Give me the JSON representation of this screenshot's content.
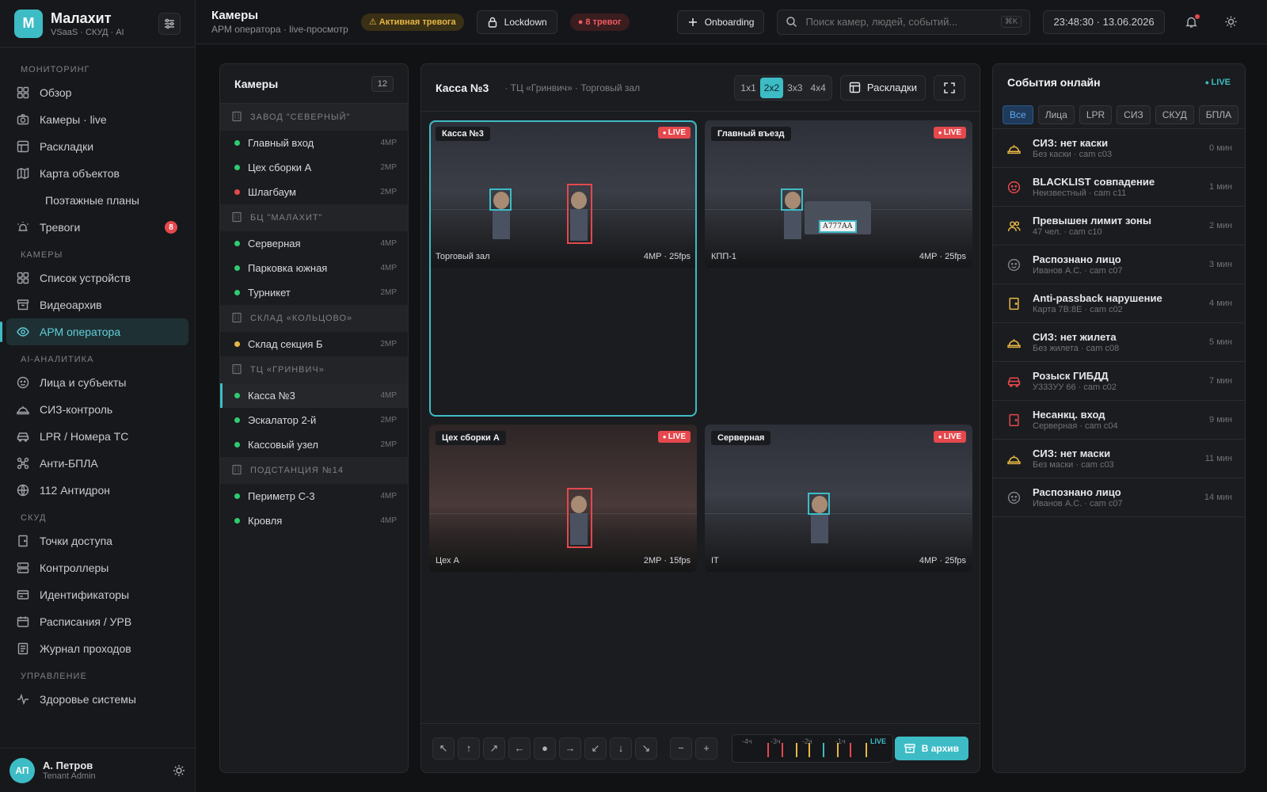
{
  "brand": {
    "logo_letter": "М",
    "name": "Малахит",
    "subtitle": "VSaaS · СКУД · AI"
  },
  "nav": {
    "sections": [
      {
        "title": "Мониторинг",
        "items": [
          {
            "label": "Обзор",
            "icon": "grid-icon"
          },
          {
            "label": "Камеры · live",
            "icon": "camera-icon"
          },
          {
            "label": "Раскладки",
            "icon": "layout-icon"
          },
          {
            "label": "Карта объектов",
            "icon": "map-icon"
          },
          {
            "label": "Поэтажные планы",
            "icon": ""
          },
          {
            "label": "Тревоги",
            "icon": "alarm-icon",
            "badge": "8"
          }
        ]
      },
      {
        "title": "Камеры",
        "items": [
          {
            "label": "Список устройств",
            "icon": "grid-icon"
          },
          {
            "label": "Видеоархив",
            "icon": "archive-icon"
          },
          {
            "label": "АРМ оператора",
            "icon": "eye-icon",
            "active": true
          }
        ]
      },
      {
        "title": "AI-аналитика",
        "items": [
          {
            "label": "Лица и субъекты",
            "icon": "face-icon"
          },
          {
            "label": "СИЗ-контроль",
            "icon": "helmet-icon"
          },
          {
            "label": "LPR / Номера ТС",
            "icon": "car-icon"
          },
          {
            "label": "Анти-БПЛА",
            "icon": "drone-icon"
          },
          {
            "label": "112 Антидрон",
            "icon": "globe-icon"
          }
        ]
      },
      {
        "title": "СКУД",
        "items": [
          {
            "label": "Точки доступа",
            "icon": "door-icon"
          },
          {
            "label": "Контроллеры",
            "icon": "server-icon"
          },
          {
            "label": "Идентификаторы",
            "icon": "card-icon"
          },
          {
            "label": "Расписания / УРВ",
            "icon": "calendar-icon"
          },
          {
            "label": "Журнал проходов",
            "icon": "log-icon"
          }
        ]
      },
      {
        "title": "Управление",
        "items": [
          {
            "label": "Здоровье системы",
            "icon": "pulse-icon"
          }
        ]
      }
    ]
  },
  "user": {
    "initials": "АП",
    "name": "А. Петров",
    "role": "Tenant Admin"
  },
  "topbar": {
    "title": "Камеры",
    "subtitle": "АРМ оператора · live-просмотр",
    "alert_chip": "⚠ Активная тревога",
    "lockdown": "Lockdown",
    "alarms_chip": "● 8 тревог",
    "onboarding": "Onboarding",
    "search_placeholder": "Поиск камер, людей, событий...",
    "search_kbd": "⌘K",
    "clock": "23:48:30 · 13.06.2026"
  },
  "cameras": {
    "title": "Камеры",
    "count": "12",
    "groups": [
      {
        "name": "ЗАВОД \"СЕВЕРНЫЙ\"",
        "items": [
          {
            "name": "Главный вход",
            "status": "#2ecc71",
            "res": "4MP"
          },
          {
            "name": "Цех сборки А",
            "status": "#2ecc71",
            "res": "2MP"
          },
          {
            "name": "Шлагбаум",
            "status": "#e5484d",
            "res": "2MP"
          }
        ]
      },
      {
        "name": "БЦ \"МАЛАХИТ\"",
        "items": [
          {
            "name": "Серверная",
            "status": "#2ecc71",
            "res": "4MP"
          },
          {
            "name": "Парковка южная",
            "status": "#2ecc71",
            "res": "4MP"
          },
          {
            "name": "Турникет",
            "status": "#2ecc71",
            "res": "2MP"
          }
        ]
      },
      {
        "name": "СКЛАД «КОЛЬЦОВО»",
        "items": [
          {
            "name": "Склад секция Б",
            "status": "#e7b744",
            "res": "2MP"
          }
        ]
      },
      {
        "name": "ТЦ «ГРИНВИЧ»",
        "items": [
          {
            "name": "Касса №3",
            "status": "#2ecc71",
            "res": "4MP",
            "active": true
          },
          {
            "name": "Эскалатор 2-й",
            "status": "#2ecc71",
            "res": "2MP"
          },
          {
            "name": "Кассовый узел",
            "status": "#2ecc71",
            "res": "2MP"
          }
        ]
      },
      {
        "name": "ПОДСТАНЦИЯ №14",
        "items": [
          {
            "name": "Периметр С-3",
            "status": "#2ecc71",
            "res": "4MP"
          },
          {
            "name": "Кровля",
            "status": "#2ecc71",
            "res": "4MP"
          }
        ]
      }
    ]
  },
  "viewer": {
    "title": "Касса №3",
    "path": "· ТЦ «Гринвич» · Торговый зал",
    "grid_options": [
      "1x1",
      "2x2",
      "3x3",
      "4x4"
    ],
    "grid_selected": "2x2",
    "layouts_label": "Раскладки",
    "tiles": [
      {
        "name": "Касса №3",
        "live": "LIVE",
        "location": "Торговый зал",
        "meta": "4MP · 25fps"
      },
      {
        "name": "Главный въезд",
        "live": "LIVE",
        "location": "КПП-1",
        "meta": "4MP · 25fps",
        "plate": "А777АА"
      },
      {
        "name": "Цех сборки А",
        "live": "LIVE",
        "location": "Цех А",
        "meta": "2MP · 15fps"
      },
      {
        "name": "Серверная",
        "live": "LIVE",
        "location": "IT",
        "meta": "4MP · 25fps"
      }
    ],
    "timeline": {
      "labels": [
        "-4ч",
        "-3ч",
        "-2ч",
        "-1ч"
      ],
      "live": "LIVE"
    },
    "archive_label": "В архив"
  },
  "events": {
    "title": "События онлайн",
    "live": "LIVE",
    "filters": [
      "Все",
      "Лица",
      "LPR",
      "СИЗ",
      "СКУД",
      "БПЛА"
    ],
    "items": [
      {
        "title": "СИЗ: нет каски",
        "sub": "Без каски · cam c03",
        "time": "0 мин",
        "icon": "helmet-icon",
        "color": "#e7b744"
      },
      {
        "title": "BLACKLIST совпадение",
        "sub": "Неизвестный · cam c11",
        "time": "1 мин",
        "icon": "face-icon",
        "color": "#e5484d"
      },
      {
        "title": "Превышен лимит зоны",
        "sub": "47 чел. · cam c10",
        "time": "2 мин",
        "icon": "users-icon",
        "color": "#e7b744"
      },
      {
        "title": "Распознано лицо",
        "sub": "Иванов А.С. · cam c07",
        "time": "3 мин",
        "icon": "face-icon",
        "color": "#7c8087"
      },
      {
        "title": "Anti-passback нарушение",
        "sub": "Карта 7B:8E · cam c02",
        "time": "4 мин",
        "icon": "door-icon",
        "color": "#e7b744"
      },
      {
        "title": "СИЗ: нет жилета",
        "sub": "Без жилета · cam c08",
        "time": "5 мин",
        "icon": "helmet-icon",
        "color": "#e7b744"
      },
      {
        "title": "Розыск ГИБДД",
        "sub": "У333УУ 66 · cam c02",
        "time": "7 мин",
        "icon": "car-icon",
        "color": "#e5484d"
      },
      {
        "title": "Несанкц. вход",
        "sub": "Серверная · cam c04",
        "time": "9 мин",
        "icon": "door-icon",
        "color": "#e5484d"
      },
      {
        "title": "СИЗ: нет маски",
        "sub": "Без маски · cam c03",
        "time": "11 мин",
        "icon": "helmet-icon",
        "color": "#e7b744"
      },
      {
        "title": "Распознано лицо",
        "sub": "Иванов А.С. · cam c07",
        "time": "14 мин",
        "icon": "face-icon",
        "color": "#7c8087"
      }
    ]
  }
}
